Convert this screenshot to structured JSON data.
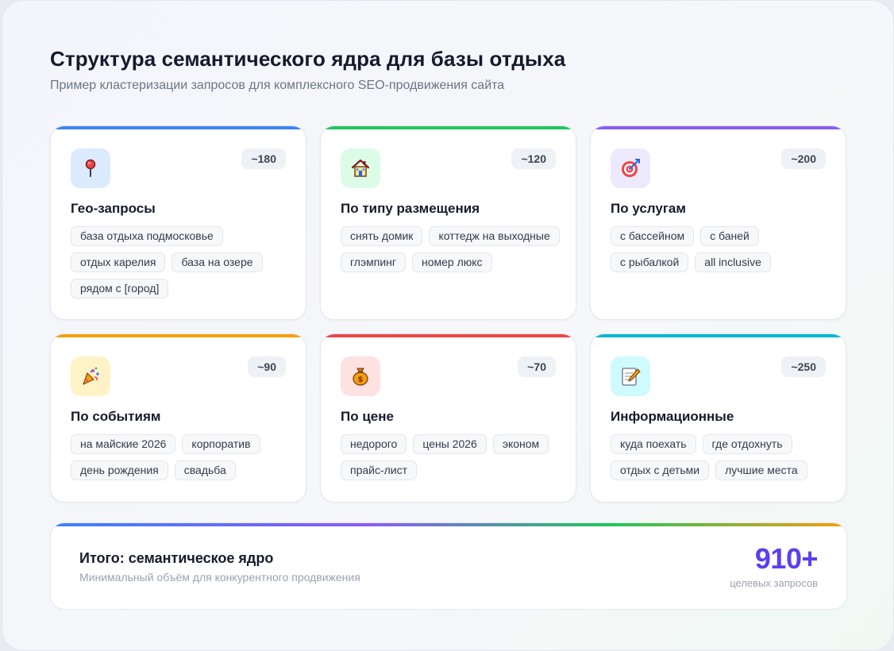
{
  "header": {
    "title": "Структура семантического ядра для базы отдыха",
    "subtitle": "Пример кластеризации запросов для комплексного SEO-продвижения сайта"
  },
  "cards": [
    {
      "icon": "pin-icon",
      "count": "~180",
      "title": "Гео-запросы",
      "accent": "#3b82f6",
      "icon_bg": "#dbeafe",
      "tags": [
        "база отдыха подмосковье",
        "отдых карелия",
        "база на озере",
        "рядом с [город]"
      ]
    },
    {
      "icon": "house-icon",
      "count": "~120",
      "title": "По типу размещения",
      "accent": "#22c55e",
      "icon_bg": "#dcfce7",
      "tags": [
        "снять домик",
        "коттедж на выходные",
        "глэмпинг",
        "номер люкс"
      ]
    },
    {
      "icon": "target-icon",
      "count": "~200",
      "title": "По услугам",
      "accent": "#8b5cf6",
      "icon_bg": "#ede9fe",
      "tags": [
        "с бассейном",
        "с баней",
        "с рыбалкой",
        "all inclusive"
      ]
    },
    {
      "icon": "party-popper-icon",
      "count": "~90",
      "title": "По событиям",
      "accent": "#f59e0b",
      "icon_bg": "#fef3c7",
      "tags": [
        "на майские 2026",
        "корпоратив",
        "день рождения",
        "свадьба"
      ]
    },
    {
      "icon": "money-bag-icon",
      "count": "~70",
      "title": "По цене",
      "accent": "#ef4444",
      "icon_bg": "#fee2e2",
      "tags": [
        "недорого",
        "цены 2026",
        "эконом",
        "прайс-лист"
      ]
    },
    {
      "icon": "memo-icon",
      "count": "~250",
      "title": "Информационные",
      "accent": "#06b6d4",
      "icon_bg": "#cffafe",
      "tags": [
        "куда поехать",
        "где отдохнуть",
        "отдых с детьми",
        "лучшие места"
      ]
    }
  ],
  "summary": {
    "title": "Итого: семантическое ядро",
    "subtitle": "Минимальный объём для конкурентного продвижения",
    "total": "910+",
    "total_label": "целевых запросов"
  }
}
